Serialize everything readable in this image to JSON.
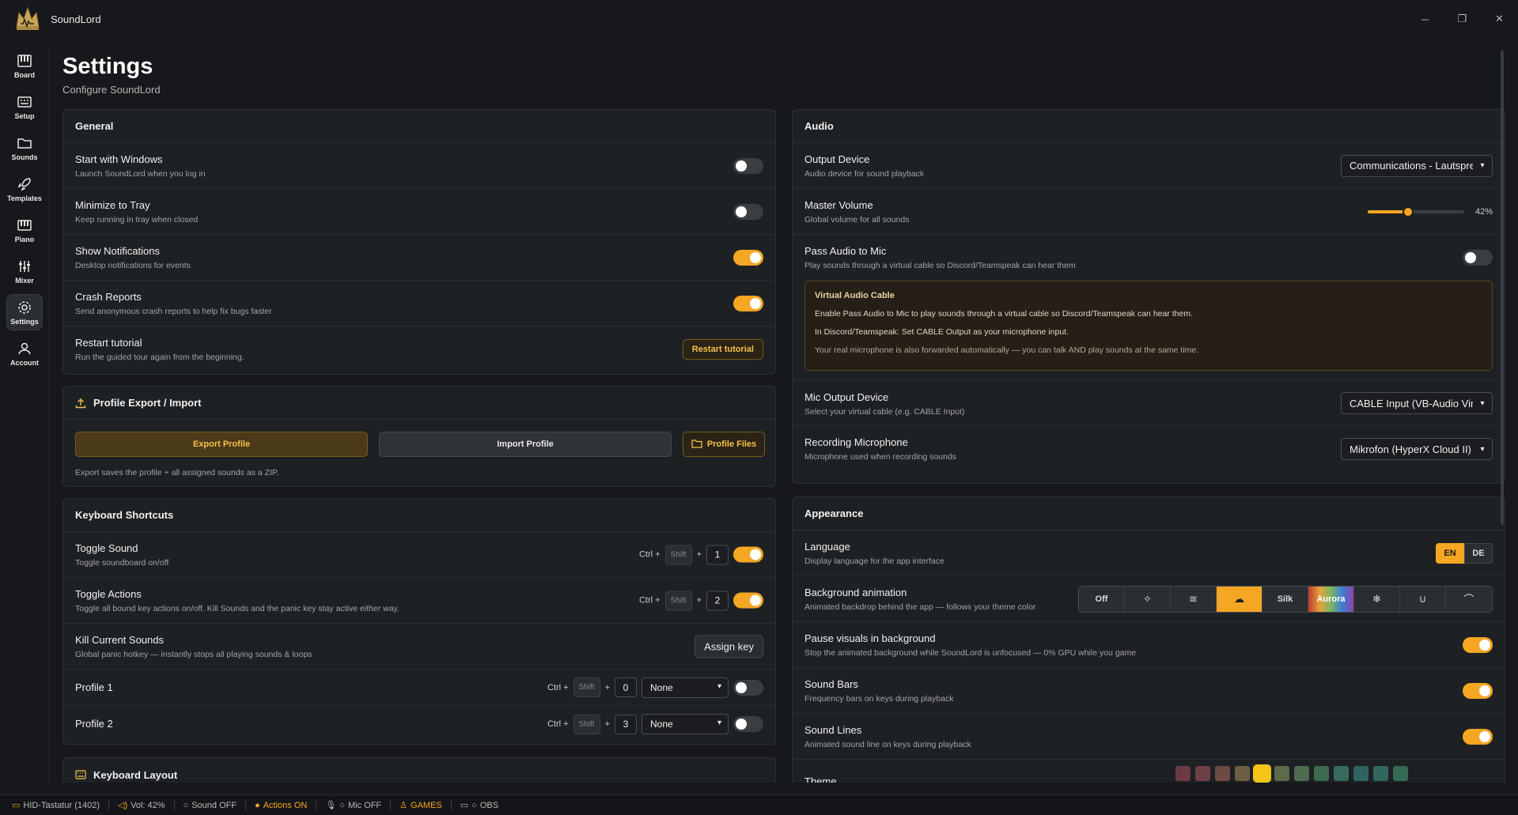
{
  "app": {
    "title": "SoundLord"
  },
  "sidebar": {
    "items": [
      {
        "label": "Board",
        "icon": "piano-keys-icon"
      },
      {
        "label": "Setup",
        "icon": "keyboard-icon"
      },
      {
        "label": "Sounds",
        "icon": "folder-icon"
      },
      {
        "label": "Templates",
        "icon": "rocket-icon"
      },
      {
        "label": "Piano",
        "icon": "piano-icon"
      },
      {
        "label": "Mixer",
        "icon": "sliders-icon"
      },
      {
        "label": "Settings",
        "icon": "gear-icon",
        "active": true
      },
      {
        "label": "Account",
        "icon": "user-icon"
      }
    ]
  },
  "page": {
    "title": "Settings",
    "subtitle": "Configure SoundLord"
  },
  "general": {
    "title": "General",
    "rows": [
      {
        "title": "Start with Windows",
        "sub": "Launch SoundLord when you log in",
        "on": false
      },
      {
        "title": "Minimize to Tray",
        "sub": "Keep running in tray when closed",
        "on": false
      },
      {
        "title": "Show Notifications",
        "sub": "Desktop notifications for events",
        "on": true
      },
      {
        "title": "Crash Reports",
        "sub": "Send anonymous crash reports to help fix bugs faster",
        "on": true
      }
    ],
    "restart": {
      "title": "Restart tutorial",
      "sub": "Run the guided tour again from the beginning.",
      "button": "Restart tutorial"
    }
  },
  "profile": {
    "title": "Profile Export / Import",
    "export": "Export Profile",
    "import": "Import Profile",
    "files": "Profile Files",
    "note": "Export saves the profile + all assigned sounds as a ZIP."
  },
  "shortcuts": {
    "title": "Keyboard Shortcuts",
    "ctrl": "Ctrl +",
    "shift": "Shift",
    "plus": "+",
    "assign": "Assign key",
    "rows": [
      {
        "title": "Toggle Sound",
        "sub": "Toggle soundboard on/off",
        "key": "1",
        "on": true
      },
      {
        "title": "Toggle Actions",
        "sub": "Toggle all bound key actions on/off. Kill Sounds and the panic key stay active either way.",
        "key": "2",
        "on": true
      },
      {
        "title": "Kill Current Sounds",
        "sub": "Global panic hotkey — instantly stops all playing sounds & loops"
      },
      {
        "title": "Profile 1",
        "key": "0",
        "select": "None",
        "on": false
      },
      {
        "title": "Profile 2",
        "key": "3",
        "select": "None",
        "on": false
      }
    ]
  },
  "layout": {
    "title": "Keyboard Layout"
  },
  "audio": {
    "title": "Audio",
    "output": {
      "title": "Output Device",
      "sub": "Audio device for sound playback",
      "value": "Communications - Lautsprecher"
    },
    "volume": {
      "title": "Master Volume",
      "sub": "Global volume for all sounds",
      "value": 42,
      "label": "42%"
    },
    "pass": {
      "title": "Pass Audio to Mic",
      "sub": "Play sounds through a virtual cable so Discord/Teamspeak can hear them",
      "on": false
    },
    "vac": {
      "title": "Virtual Audio Cable",
      "l1": "Enable Pass Audio to Mic to play sounds through a virtual cable so Discord/Teamspeak can hear them.",
      "l2": "In Discord/Teamspeak: Set CABLE Output as your microphone input.",
      "l3": "Your real microphone is also forwarded automatically — you can talk AND play sounds at the same time."
    },
    "mic": {
      "title": "Mic Output Device",
      "sub": "Select your virtual cable (e.g. CABLE Input)",
      "value": "CABLE Input (VB-Audio Virtual Cable)"
    },
    "rec": {
      "title": "Recording Microphone",
      "sub": "Microphone used when recording sounds",
      "value": "Mikrofon (HyperX Cloud II)"
    }
  },
  "appearance": {
    "title": "Appearance",
    "language": {
      "title": "Language",
      "sub": "Display language for the app interface",
      "options": [
        "EN",
        "DE"
      ],
      "selected": "EN"
    },
    "bganim": {
      "title": "Background animation",
      "sub": "Animated backdrop behind the app — follows your theme color",
      "off": "Off",
      "silk": "Silk",
      "aurora": "Aurora"
    },
    "pause": {
      "title": "Pause visuals in background",
      "sub": "Stop the animated background while SoundLord is unfocused — 0% GPU while you game",
      "on": true
    },
    "bars": {
      "title": "Sound Bars",
      "sub": "Frequency bars on keys during playback",
      "on": true
    },
    "lines": {
      "title": "Sound Lines",
      "sub": "Animated sound line on keys during playback",
      "on": true
    },
    "theme": {
      "title": "Theme",
      "swatches": [
        "#6b3a45",
        "#6e3f47",
        "#6e4a44",
        "#6e5e44",
        "#f5c518",
        "#5e6b4a",
        "#4d6b4f",
        "#3d6b52",
        "#37695c",
        "#2f6461",
        "#32675f",
        "#356a55"
      ]
    }
  },
  "status": {
    "device": "HID-Tastatur (1402)",
    "vol": "Vol: 42%",
    "sound": "Sound OFF",
    "actions": "Actions ON",
    "mic": "Mic OFF",
    "games": "GAMES",
    "obs": "OBS",
    "accent": "#f5a623"
  }
}
